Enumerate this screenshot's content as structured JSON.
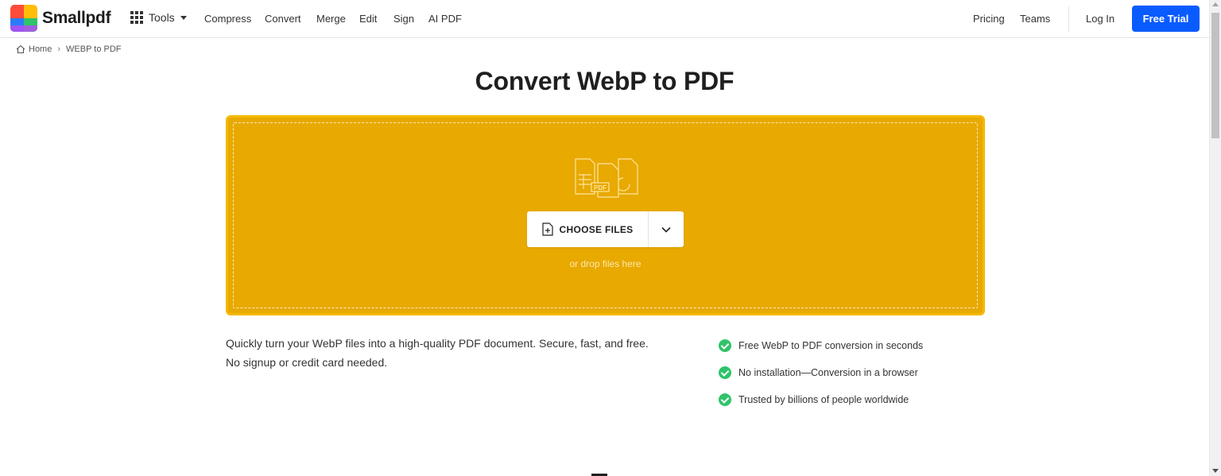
{
  "header": {
    "logo_text": "Smallpdf",
    "tools_label": "Tools",
    "nav": [
      "Compress",
      "Convert",
      "Merge",
      "Edit",
      "Sign",
      "AI PDF"
    ],
    "pricing_label": "Pricing",
    "teams_label": "Teams",
    "login_label": "Log In",
    "trial_label": "Free Trial"
  },
  "breadcrumb": {
    "home": "Home",
    "separator": "›",
    "current": "WEBP to PDF"
  },
  "page_title": "Convert WebP to PDF",
  "dropzone": {
    "choose_label": "CHOOSE FILES",
    "hint": "or drop files here",
    "illus_label": "PDF"
  },
  "description": {
    "line1": "Quickly turn your WebP files into a high-quality PDF document. Secure, fast, and free.",
    "line2": "No signup or credit card needed."
  },
  "features": [
    "Free WebP to PDF conversion in seconds",
    "No installation—Conversion in a browser",
    "Trusted by billions of people worldwide"
  ],
  "colors": {
    "accent": "#0a5bff",
    "dropzone": "#e8a900",
    "check": "#2fc36a"
  }
}
